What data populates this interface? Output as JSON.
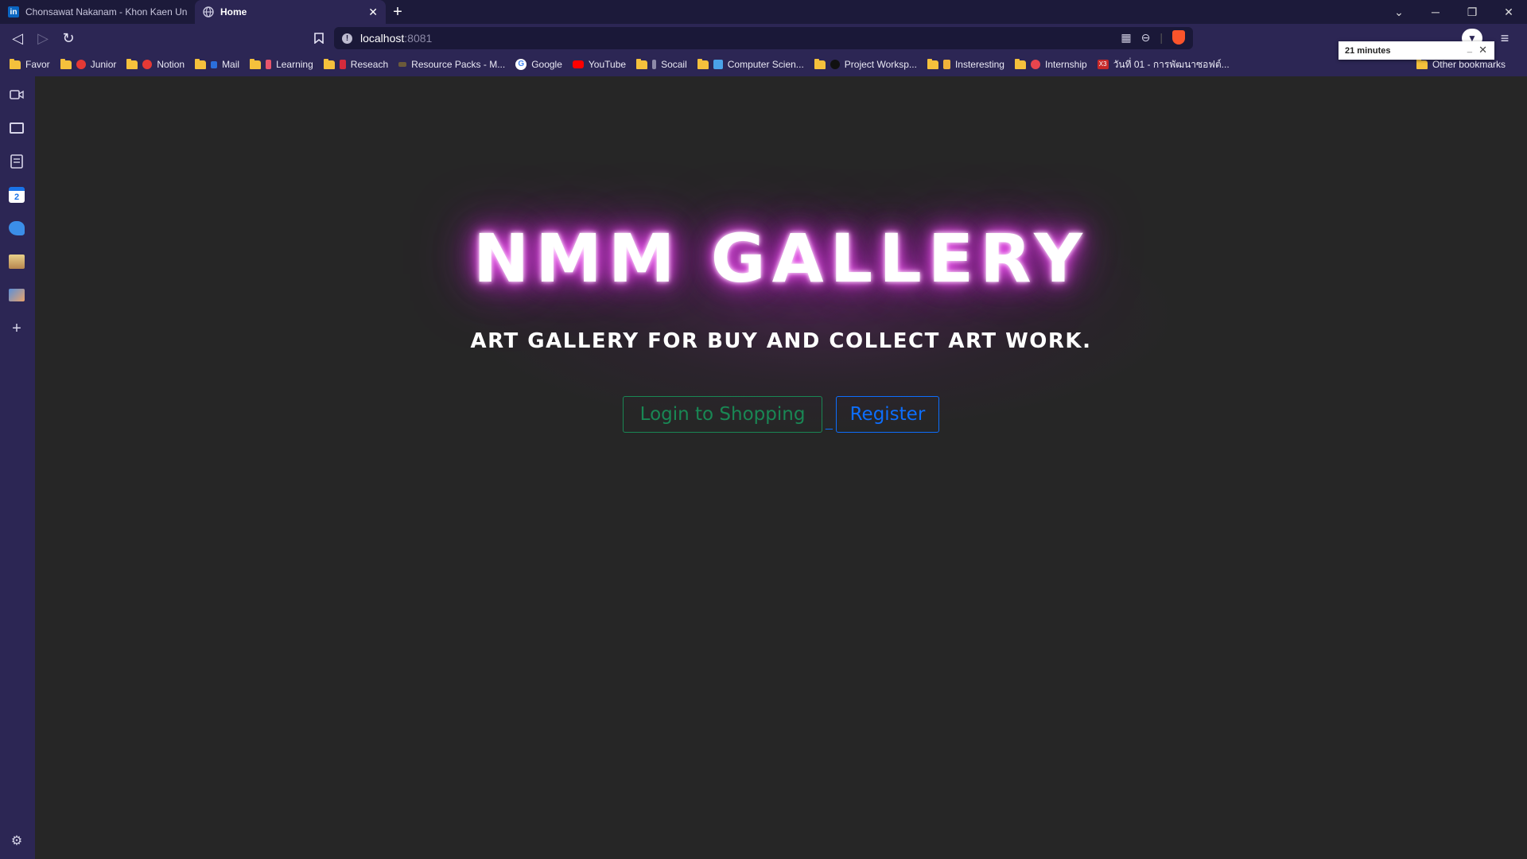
{
  "tabs": [
    {
      "title": "Chonsawat Nakanam - Khon Kaen Uni",
      "icon": "linkedin-icon",
      "active": false
    },
    {
      "title": "Home",
      "icon": "globe-icon",
      "active": true
    }
  ],
  "toolbar": {
    "url_host": "localhost",
    "url_port": ":8081"
  },
  "bookmarks": [
    {
      "label": "Favor",
      "icon": "folder-icon"
    },
    {
      "label": "Junior",
      "icon": "red-circle-icon"
    },
    {
      "label": "Notion",
      "icon": "red-circle-icon"
    },
    {
      "label": "Mail",
      "icon": "mail-icon"
    },
    {
      "label": "Learning",
      "icon": "learning-icon"
    },
    {
      "label": "Reseach",
      "icon": "research-icon"
    },
    {
      "label": "Resource Packs - M...",
      "icon": "resource-icon"
    },
    {
      "label": "Google",
      "icon": "google-icon"
    },
    {
      "label": "YouTube",
      "icon": "youtube-icon"
    },
    {
      "label": "Socail",
      "icon": "social-icon"
    },
    {
      "label": "Computer Scien...",
      "icon": "computer-icon"
    },
    {
      "label": "Project Worksp...",
      "icon": "project-icon"
    },
    {
      "label": "Insteresting",
      "icon": "interesting-icon"
    },
    {
      "label": "Internship",
      "icon": "internship-icon"
    },
    {
      "label": "วันที่ 01 - การพัฒนาซอฟต์...",
      "icon": "x3-icon"
    }
  ],
  "other_bookmarks": "Other bookmarks",
  "timer": {
    "label": "21 minutes"
  },
  "hero": {
    "title": "NMM GALLERY",
    "subtitle": "ART GALLERY FOR BUY AND COLLECT ART WORK.",
    "login_label": "Login to Shopping",
    "separator": "_",
    "register_label": "Register"
  },
  "colors": {
    "glow": "#d43fd8",
    "login": "#198754",
    "register": "#0d6efd",
    "browser_chrome": "#2c2654",
    "page_bg": "#262626"
  }
}
